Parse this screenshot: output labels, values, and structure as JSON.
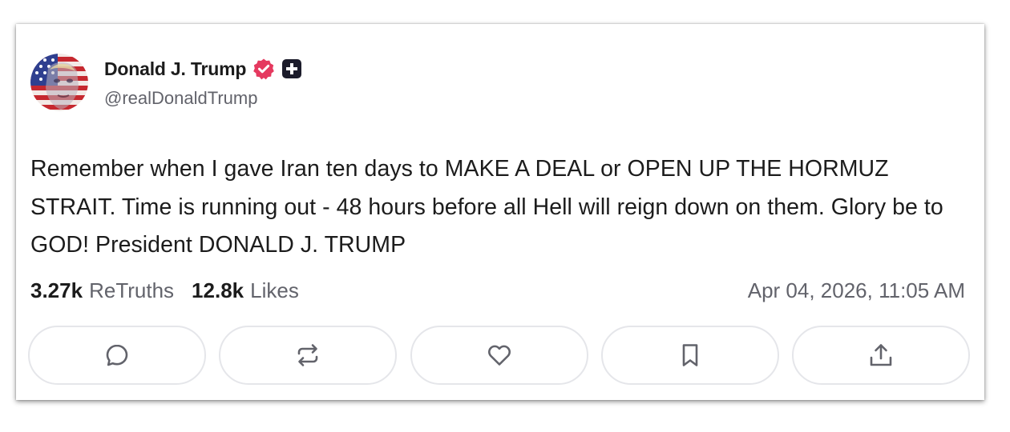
{
  "post": {
    "author_name": "Donald J. Trump",
    "handle": "@realDonaldTrump",
    "text": "Remember when I gave Iran ten days to MAKE A DEAL or OPEN UP THE HORMUZ STRAIT. Time is running out - 48 hours before all Hell will reign down on them. Glory be to GOD! President DONALD J. TRUMP",
    "retruths_count": "3.27k",
    "retruths_label": "ReTruths",
    "likes_count": "12.8k",
    "likes_label": "Likes",
    "timestamp": "Apr 04, 2026, 11:05 AM"
  },
  "badges": {
    "verified_icon": "verified-badge-icon",
    "verified_color": "#e5395f",
    "plus_icon": "truth-plus-icon",
    "plus_color": "#1c1c2b"
  },
  "actions": [
    {
      "icon": "reply-icon"
    },
    {
      "icon": "retruth-icon"
    },
    {
      "icon": "like-icon"
    },
    {
      "icon": "bookmark-icon"
    },
    {
      "icon": "share-icon"
    }
  ],
  "colors": {
    "text_primary": "#1c1c1c",
    "text_secondary": "#62636b",
    "button_border": "#e5e6ea",
    "icon_color": "#62636b"
  }
}
